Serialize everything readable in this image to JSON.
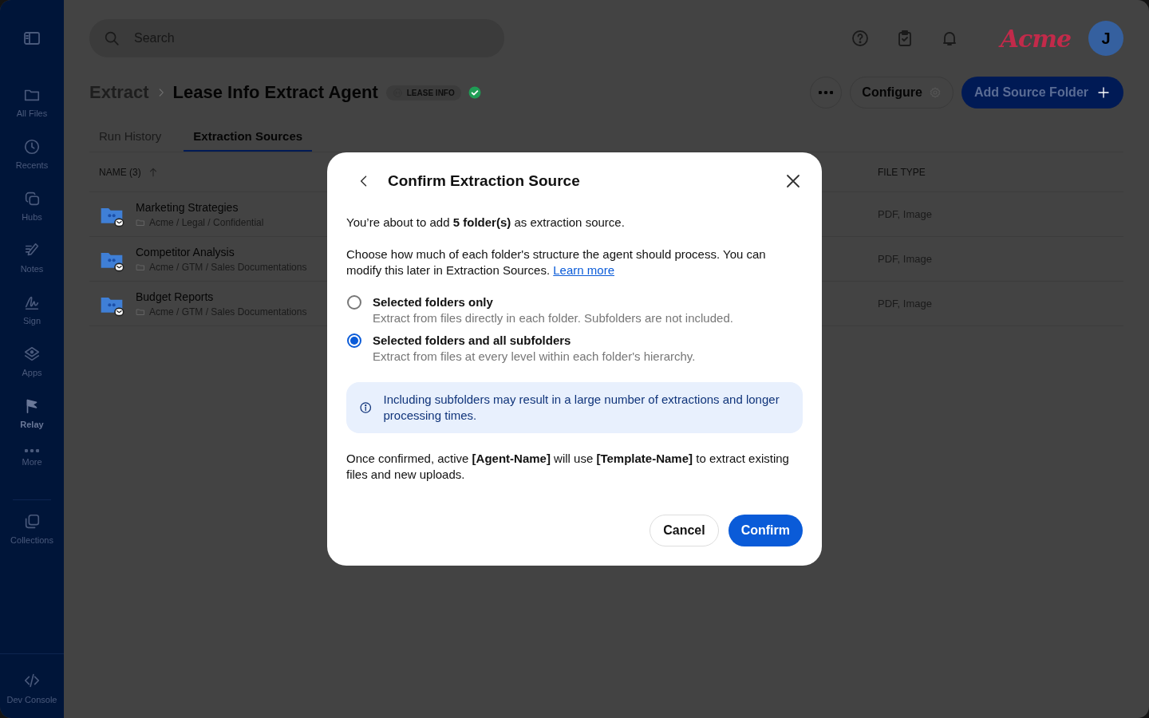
{
  "sidebar": {
    "items": [
      {
        "label": "All Files",
        "selected": false
      },
      {
        "label": "Recents",
        "selected": false
      },
      {
        "label": "Hubs",
        "selected": false
      },
      {
        "label": "Notes",
        "selected": false
      },
      {
        "label": "Sign",
        "selected": false
      },
      {
        "label": "Apps",
        "selected": false
      },
      {
        "label": "Relay",
        "selected": true
      },
      {
        "label": "More",
        "selected": false
      },
      {
        "label": "Collections",
        "selected": false
      }
    ],
    "footer": {
      "label": "Dev Console"
    }
  },
  "header": {
    "search": {
      "placeholder": "Search"
    },
    "logo": "Acme",
    "avatar": "J"
  },
  "breadcrumb": {
    "parent": "Extract",
    "title": "Lease Info Extract Agent",
    "badge": "LEASE INFO",
    "verified": true
  },
  "actions": {
    "configure": "Configure",
    "add": "Add Source Folder"
  },
  "tabs": [
    {
      "label": "Run History",
      "selected": false
    },
    {
      "label": "Extraction Sources",
      "selected": true
    }
  ],
  "table": {
    "columns": [
      "NAME (3)",
      "FILE TYPE"
    ],
    "rows": [
      {
        "name": "Marketing Strategies",
        "path": "Acme / Legal / Confidential",
        "file_type": "PDF, Image"
      },
      {
        "name": "Competitor Analysis",
        "path": "Acme / GTM / Sales Documentations",
        "file_type": "PDF, Image"
      },
      {
        "name": "Budget Reports",
        "path": "Acme / GTM / Sales Documentations",
        "file_type": "PDF, Image"
      }
    ]
  },
  "dialog": {
    "title": "Confirm Extraction Source",
    "intro": "You’re about to add **5 folder(s)** as extraction source.",
    "description": "Choose how much of each folder's structure the agent should process. You can modify this later in Extraction Sources.",
    "link": "Learn more",
    "options": [
      {
        "label": "Selected folders only",
        "hint": "Extract from files directly in each folder. Subfolders are not included.",
        "selected": false
      },
      {
        "label": "Selected folders and all subfolders",
        "hint": "Extract from files at every level within each folder's hierarchy.",
        "selected": true
      }
    ],
    "notice": "Including subfolders may result in a large number of extractions and longer processing times.",
    "outro": "Once confirmed, active **[Agent-Name]** will use **[Template-Name]** to extract existing files and new uploads.",
    "buttons": {
      "cancel": "Cancel",
      "confirm": "Confirm"
    }
  }
}
